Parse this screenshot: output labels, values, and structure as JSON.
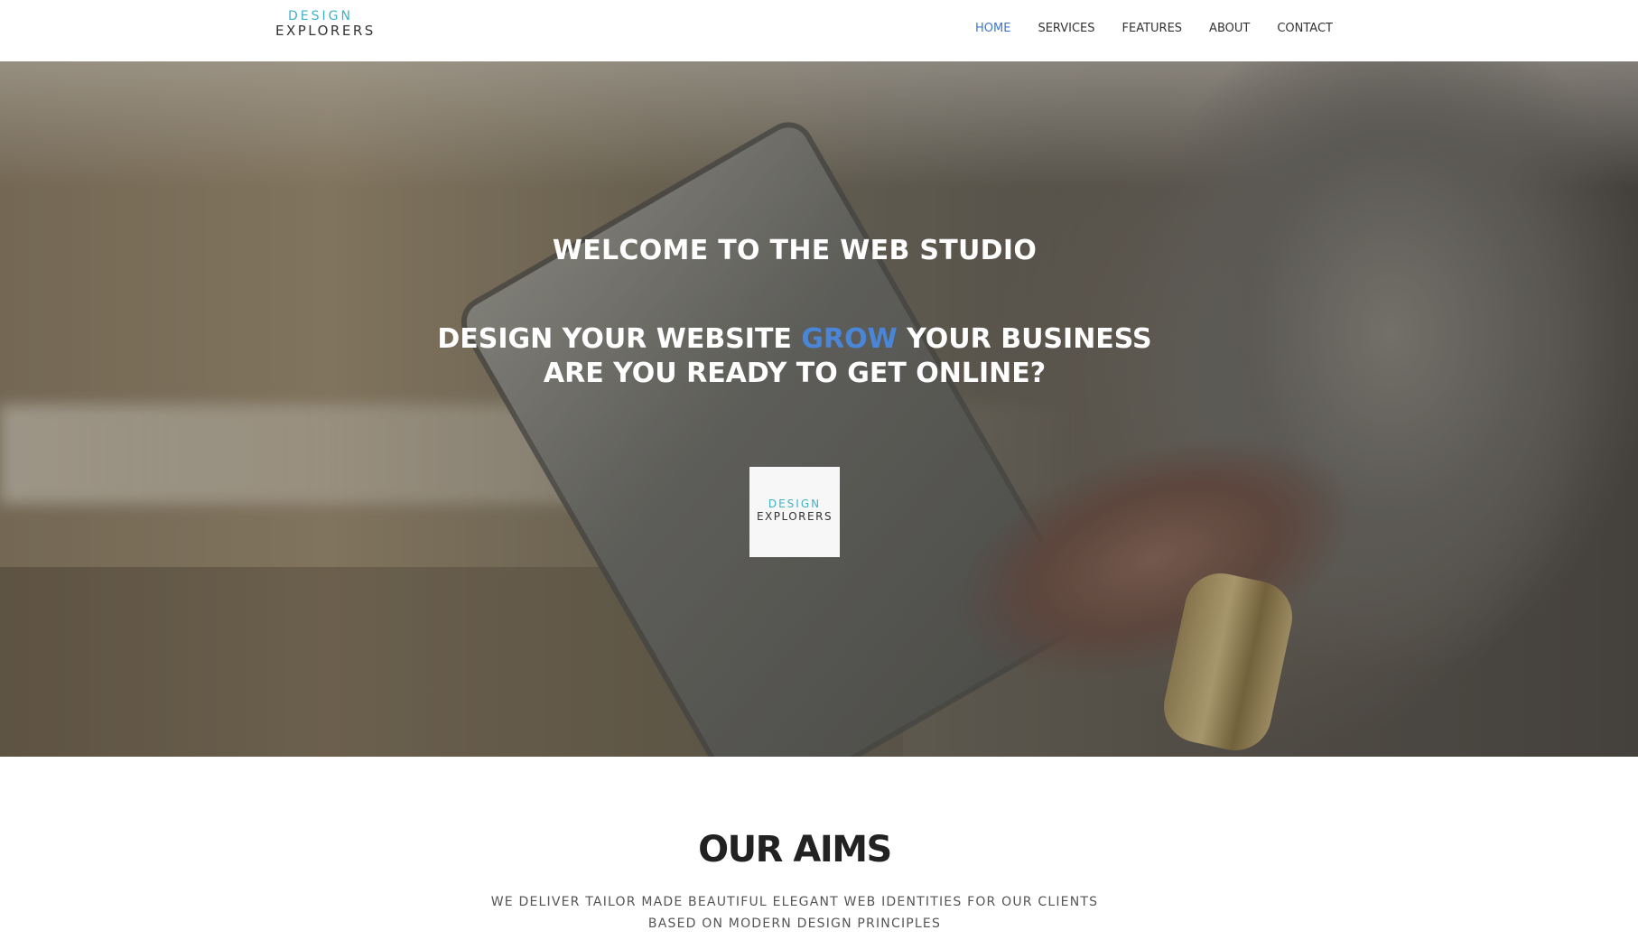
{
  "brand": {
    "logo_line1": "DESIGN",
    "logo_line2": "EXPLORERS",
    "accent_color": "#3fb3c4"
  },
  "nav": {
    "items": [
      {
        "label": "HOME",
        "active": true
      },
      {
        "label": "SERVICES",
        "active": false
      },
      {
        "label": "FEATURES",
        "active": false
      },
      {
        "label": "ABOUT",
        "active": false
      },
      {
        "label": "CONTACT",
        "active": false
      }
    ],
    "active_color": "#3a78c9"
  },
  "hero": {
    "title": "WELCOME TO THE WEB STUDIO",
    "line1_start": "DESIGN YOUR WEBSITE",
    "line1_accent": "GROW",
    "line1_end": "YOUR BUSINESS",
    "line2": "ARE YOU READY TO GET ONLINE?",
    "accent_color": "#4a86d8",
    "badge_line1": "DESIGN",
    "badge_line2": "EXPLORERS"
  },
  "aims": {
    "title": "OUR AIMS",
    "line1": "WE DELIVER TAILOR MADE BEAUTIFUL ELEGANT WEB IDENTITIES FOR OUR CLIENTS",
    "line2": "BASED ON MODERN DESIGN PRINCIPLES"
  }
}
